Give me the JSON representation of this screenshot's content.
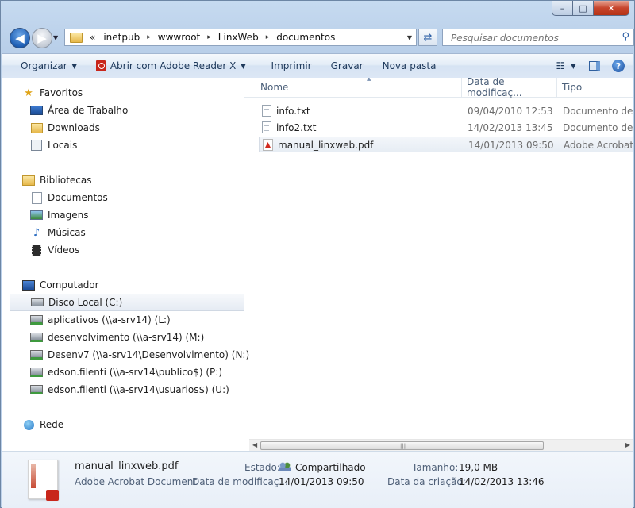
{
  "window": {
    "minimize": "–",
    "maximize": "□",
    "close": "✕"
  },
  "address": {
    "overflow": "«",
    "crumbs": [
      "inetpub",
      "wwwroot",
      "LinxWeb",
      "documentos"
    ],
    "separator": "▸"
  },
  "search": {
    "placeholder": "Pesquisar documentos"
  },
  "toolbar": {
    "organize": "Organizar",
    "open_with": "Abrir com Adobe Reader X",
    "print": "Imprimir",
    "burn": "Gravar",
    "new_folder": "Nova pasta"
  },
  "nav": {
    "favorites": {
      "label": "Favoritos",
      "items": [
        "Área de Trabalho",
        "Downloads",
        "Locais"
      ]
    },
    "libraries": {
      "label": "Bibliotecas",
      "items": [
        "Documentos",
        "Imagens",
        "Músicas",
        "Vídeos"
      ]
    },
    "computer": {
      "label": "Computador",
      "items": [
        "Disco Local (C:)",
        "aplicativos (\\\\a-srv14) (L:)",
        "desenvolvimento (\\\\a-srv14) (M:)",
        "Desenv7 (\\\\a-srv14\\Desenvolvimento) (N:)",
        "edson.filenti (\\\\a-srv14\\publico$) (P:)",
        "edson.filenti (\\\\a-srv14\\usuarios$) (U:)"
      ]
    },
    "network": {
      "label": "Rede"
    }
  },
  "columns": {
    "name": "Nome",
    "date": "Data de modificaç...",
    "type": "Tipo"
  },
  "files": [
    {
      "name": "info.txt",
      "date": "09/04/2010 12:53",
      "type": "Documento de T"
    },
    {
      "name": "info2.txt",
      "date": "14/02/2013 13:45",
      "type": "Documento de T"
    },
    {
      "name": "manual_linxweb.pdf",
      "date": "14/01/2013 09:50",
      "type": "Adobe Acrobat D"
    }
  ],
  "details": {
    "filename": "manual_linxweb.pdf",
    "filetype": "Adobe Acrobat Document",
    "state_label": "Estado:",
    "state_value": "Compartilhado",
    "modified_label": "Data de modificaç...",
    "modified_value": "14/01/2013 09:50",
    "size_label": "Tamanho:",
    "size_value": "19,0 MB",
    "created_label": "Data da criação:",
    "created_value": "14/02/2013 13:46"
  },
  "colors": {
    "accent": "#1e5fb5",
    "selection": "#e5ebf3",
    "frame": "#c6daf0"
  }
}
